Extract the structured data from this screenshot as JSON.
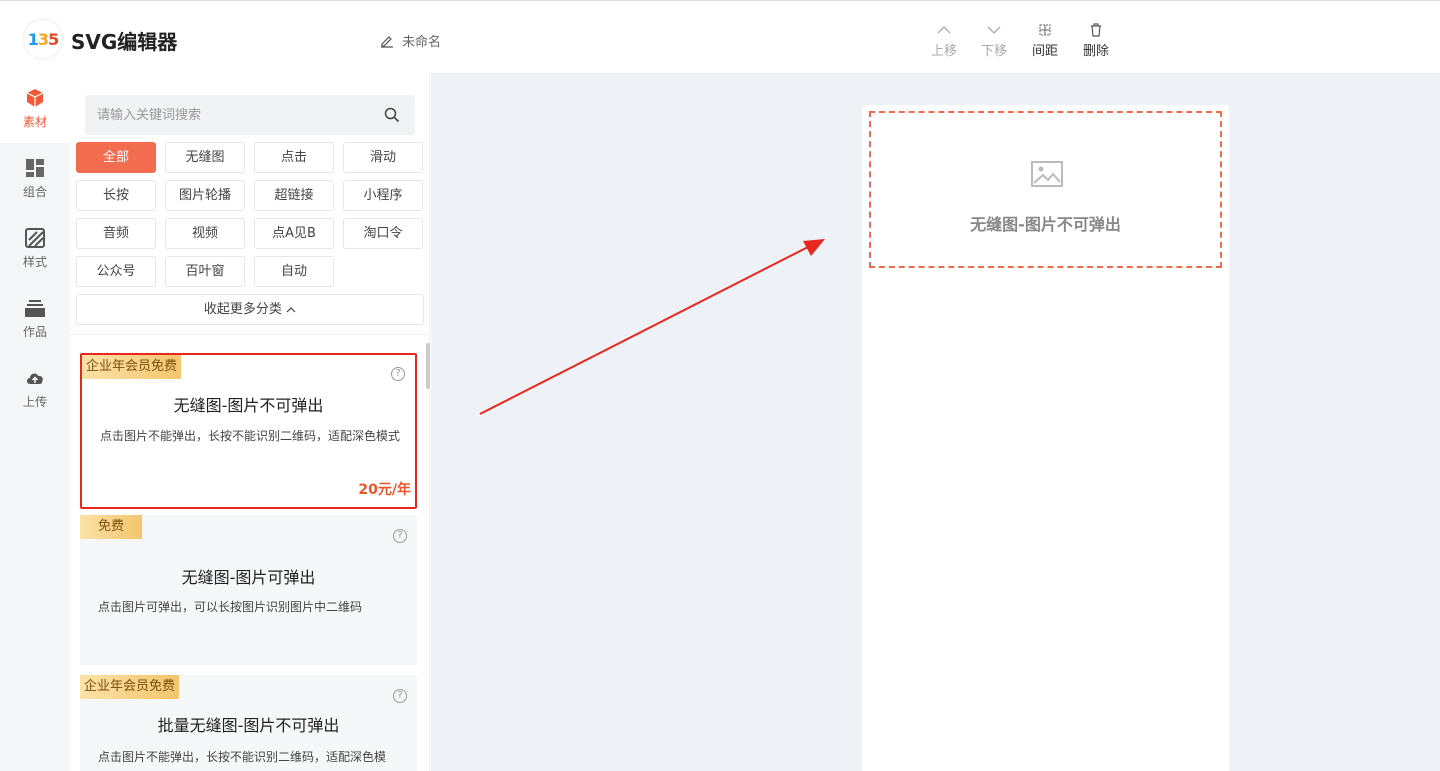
{
  "header": {
    "logo_text": "135",
    "app_title": "SVG编辑器",
    "doc_name": "未命名",
    "tools": [
      {
        "label": "上移",
        "icon": "chevron-up-icon",
        "enabled": false
      },
      {
        "label": "下移",
        "icon": "chevron-down-icon",
        "enabled": false
      },
      {
        "label": "间距",
        "icon": "spacing-icon",
        "enabled": true
      },
      {
        "label": "删除",
        "icon": "trash-icon",
        "enabled": true
      }
    ]
  },
  "rail": {
    "items": [
      {
        "label": "素材",
        "icon": "cube-icon",
        "active": true
      },
      {
        "label": "组合",
        "icon": "layout-icon",
        "active": false
      },
      {
        "label": "样式",
        "icon": "style-icon",
        "active": false
      },
      {
        "label": "作品",
        "icon": "stack-icon",
        "active": false
      },
      {
        "label": "上传",
        "icon": "cloud-upload-icon",
        "active": false
      }
    ]
  },
  "search": {
    "placeholder": "请输入关键词搜索"
  },
  "categories": [
    "全部",
    "无缝图",
    "点击",
    "滑动",
    "长按",
    "图片轮播",
    "超链接",
    "小程序",
    "音频",
    "视频",
    "点A见B",
    "淘口令",
    "公众号",
    "百叶窗",
    "自动"
  ],
  "active_category": "全部",
  "collapse_label": "收起更多分类",
  "cards": [
    {
      "badge": "企业年会员免费",
      "title": "无缝图-图片不可弹出",
      "desc": "点击图片不能弹出，长按不能识别二维码，适配深色模式",
      "price": "20元/年",
      "selected": true
    },
    {
      "badge": "免费",
      "title": "无缝图-图片可弹出",
      "desc": "点击图片可弹出，可以长按图片识别图片中二维码",
      "price": "",
      "selected": false
    },
    {
      "badge": "企业年会员免费",
      "title": "批量无缝图-图片不可弹出",
      "desc": "点击图片不能弹出，长按不能识别二维码，适配深色模",
      "price": "",
      "selected": false
    }
  ],
  "canvas": {
    "placeholder_text": "无缝图-图片不可弹出"
  },
  "colors": {
    "accent": "#f26c4f",
    "highlight": "#e8271e",
    "price": "#e8562a"
  }
}
